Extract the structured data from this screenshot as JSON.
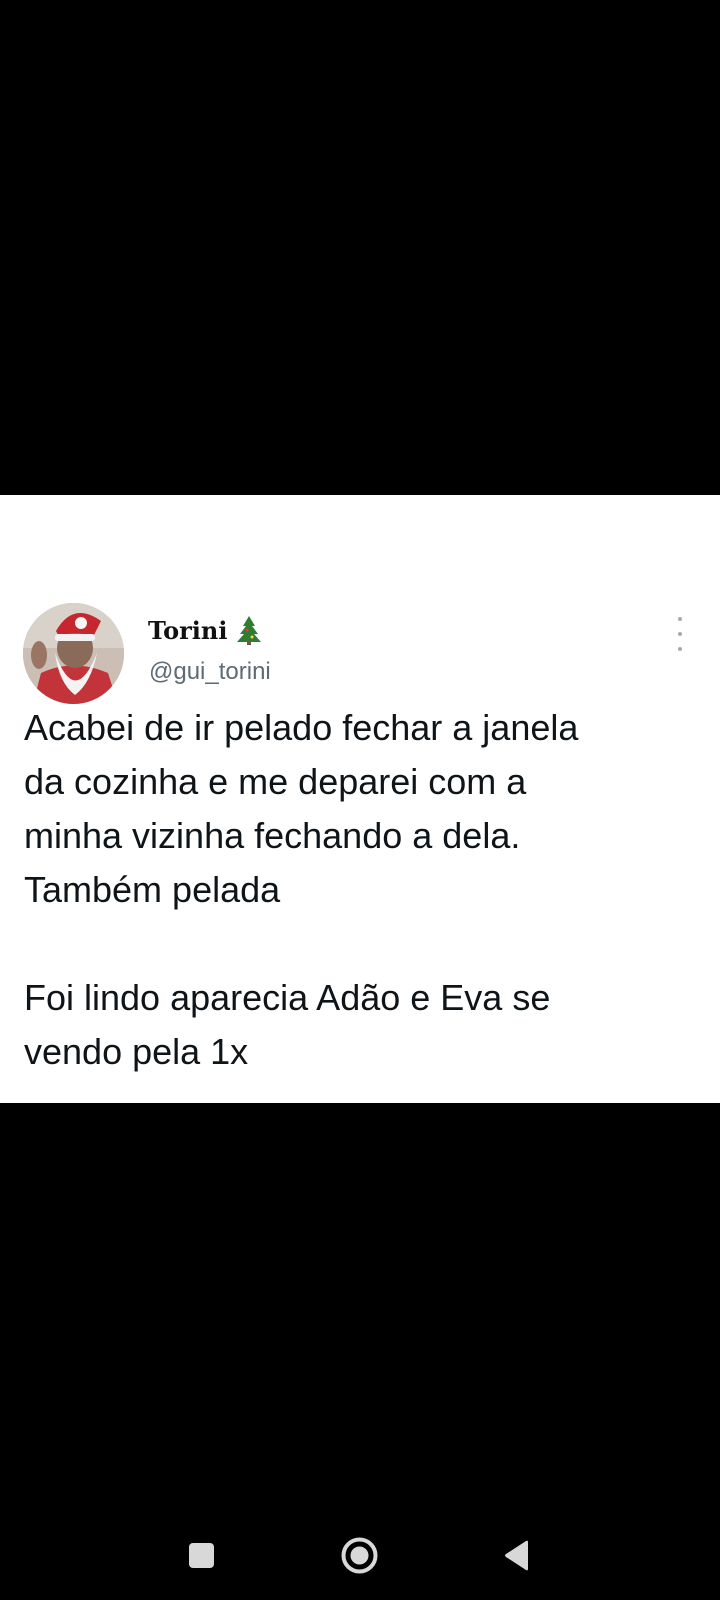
{
  "tweet": {
    "display_name": "Torini",
    "name_emoji_icon": "christmas-tree-icon",
    "handle": "@gui_torini",
    "text": "Acabei de ir pelado fechar a janela\nda cozinha e me deparei com a\nminha vizinha fechando a dela.\nTambém pelada\n\nFoi lindo aparecia Adão e Eva se\nvendo pela 1x",
    "avatar_icon": "santa-avatar-icon",
    "menu_icon": "more-vertical-icon"
  },
  "nav_bar": {
    "recents_icon": "square-icon",
    "home_icon": "circle-home-icon",
    "back_icon": "triangle-back-icon"
  },
  "colors": {
    "background": "#000000",
    "card": "#ffffff",
    "text": "#0f1419",
    "handle": "#5e6a74",
    "nav_icons": "#d8d8d8"
  }
}
